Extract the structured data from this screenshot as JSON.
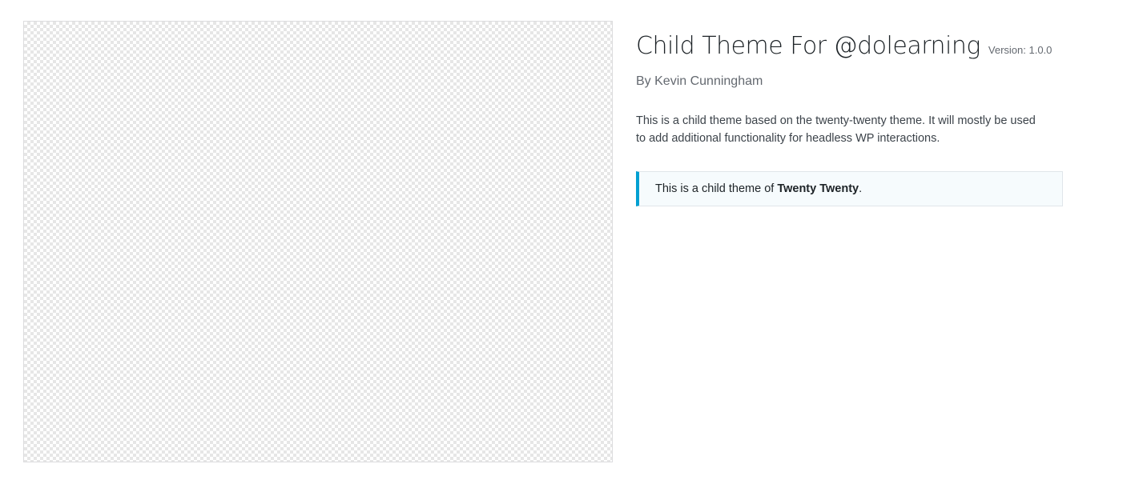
{
  "theme": {
    "name": "Child Theme For @dolearning",
    "version": "Version: 1.0.0",
    "author": "By Kevin Cunningham",
    "description": "This is a child theme based on the twenty-twenty theme. It will mostly be used to add additional functionality for headless WP interactions."
  },
  "parent_notice": {
    "prefix": "This is a child theme of ",
    "parent_name": "Twenty Twenty",
    "suffix": "."
  },
  "colors": {
    "notice_accent": "#00a0d2",
    "notice_background": "#f6fbfd"
  }
}
